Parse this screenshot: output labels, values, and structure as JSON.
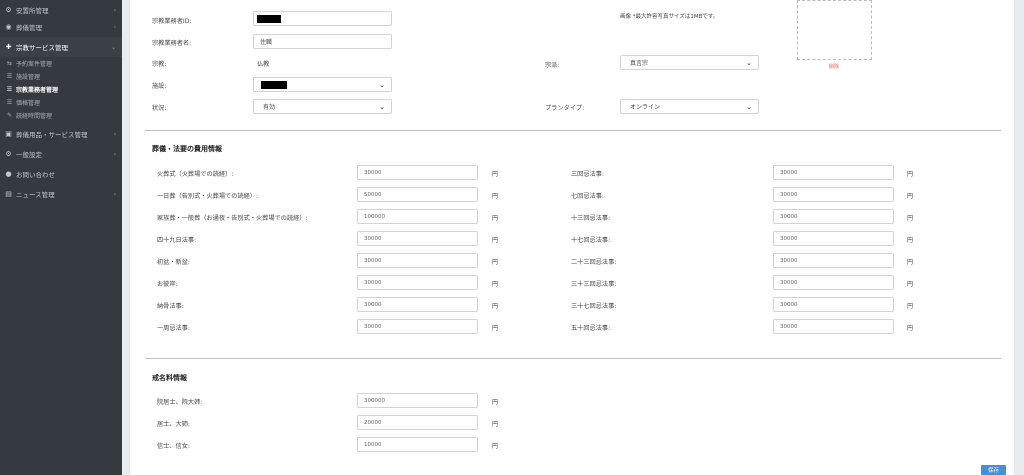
{
  "sidebar": {
    "items": [
      {
        "label": "安置所管理",
        "icon": "⚙",
        "chevron": "‹"
      },
      {
        "label": "葬儀管理",
        "icon": "◉",
        "chevron": "‹"
      },
      {
        "label": "宗教サービス管理",
        "icon": "✚",
        "chevron": "⌄"
      },
      {
        "label": "葬儀用品・サービス管理",
        "icon": "▣",
        "chevron": "‹"
      },
      {
        "label": "一般設定",
        "icon": "⚙",
        "chevron": "‹"
      },
      {
        "label": "お問い合わせ",
        "icon": "●",
        "chevron": ""
      },
      {
        "label": "ニュース管理",
        "icon": "▤",
        "chevron": "‹"
      }
    ],
    "subitems": [
      {
        "label": "予約案件管理",
        "icon": "⇆"
      },
      {
        "label": "施設管理",
        "icon": "☰"
      },
      {
        "label": "宗教業務者管理",
        "icon": "☰"
      },
      {
        "label": "価格管理",
        "icon": "☰"
      },
      {
        "label": "読経時間管理",
        "icon": "✎"
      }
    ]
  },
  "form": {
    "id_label": "宗教業務者ID:",
    "name_label": "宗教業務者名:",
    "name_value": "住職",
    "religion_label": "宗教:",
    "religion_value": "仏教",
    "sect_label": "宗派:",
    "sect_value": "真言宗",
    "facility_label": "施設:",
    "status_label": "状況:",
    "status_value": "有効",
    "plan_label": "プランタイプ:",
    "plan_value": "オンライン",
    "photo_note": "画像 *最大許容写真サイズは1MBです。",
    "delete_label": "削除"
  },
  "fees": {
    "title": "葬儀・法要の費用情報",
    "currency": "円",
    "left": [
      {
        "label": "火葬式（火葬場での読経）:",
        "value": "30000"
      },
      {
        "label": "一日葬（告別式・火葬場での読経）:",
        "value": "50000"
      },
      {
        "label": "家族葬・一般葬（お通夜・告別式・火葬場での読経）:",
        "value": "100000"
      },
      {
        "label": "四十九日法事:",
        "value": "30000"
      },
      {
        "label": "初盆・新盆:",
        "value": "30000"
      },
      {
        "label": "お彼岸:",
        "value": "30000"
      },
      {
        "label": "納骨法事:",
        "value": "30000"
      },
      {
        "label": "一周忌法事:",
        "value": "30000"
      }
    ],
    "right": [
      {
        "label": "三回忌法事:",
        "value": "30000"
      },
      {
        "label": "七回忌法事:",
        "value": "30000"
      },
      {
        "label": "十三回忌法事:",
        "value": "30000"
      },
      {
        "label": "十七回忌法事:",
        "value": "30000"
      },
      {
        "label": "二十三回忌法事:",
        "value": "30000"
      },
      {
        "label": "三十三回忌法事:",
        "value": "30000"
      },
      {
        "label": "三十七回忌法事:",
        "value": "30000"
      },
      {
        "label": "五十回忌法事:",
        "value": "30000"
      }
    ]
  },
  "kaimyo": {
    "title": "戒名料情報",
    "currency": "円",
    "rows": [
      {
        "label": "院居士、院大姉:",
        "value": "300000"
      },
      {
        "label": "居士、大姉:",
        "value": "20000"
      },
      {
        "label": "信士、信女:",
        "value": "10000"
      }
    ]
  },
  "actions": {
    "save_label": "保存"
  }
}
